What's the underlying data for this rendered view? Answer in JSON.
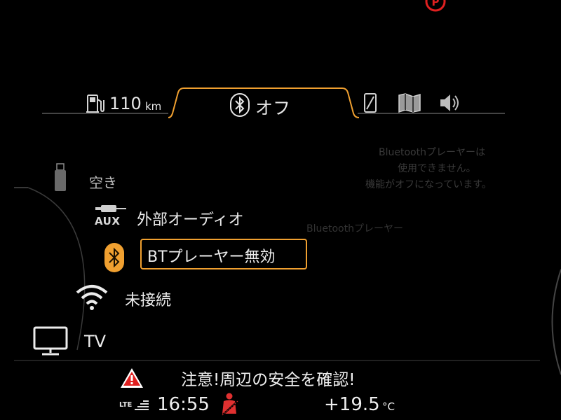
{
  "tab_bar": {
    "range_value": "110",
    "range_unit": "km",
    "bluetooth_status": "オフ"
  },
  "sources": {
    "usb_label": "空き",
    "aux_badge": "AUX",
    "aux_label": "外部オーディオ",
    "bt_label": "BTプレーヤー無効",
    "wifi_label": "未接続",
    "tv_label": "TV"
  },
  "background_message": {
    "line1": "Bluetoothプレーヤーは",
    "line2": "使用できません。",
    "line3": "機能がオフになっています。",
    "title": "Bluetoothプレーヤー"
  },
  "status_bar": {
    "warning": "注意!周辺の安全を確認!",
    "network": "LTE",
    "time": "16:55",
    "temperature": "+19.5",
    "temperature_unit": "°C"
  },
  "colors": {
    "accent_orange": "#f0a030",
    "parking_brake_red": "#e02020",
    "seatbelt_red": "#e03030"
  },
  "icons": [
    "parking-brake-icon",
    "fuel-pump-icon",
    "bluetooth-icon",
    "phone-icon",
    "map-book-icon",
    "speaker-icon",
    "usb-icon",
    "aux-cable-icon",
    "wifi-icon",
    "tv-icon",
    "warning-triangle-icon",
    "lte-signal-icon",
    "seatbelt-icon"
  ]
}
